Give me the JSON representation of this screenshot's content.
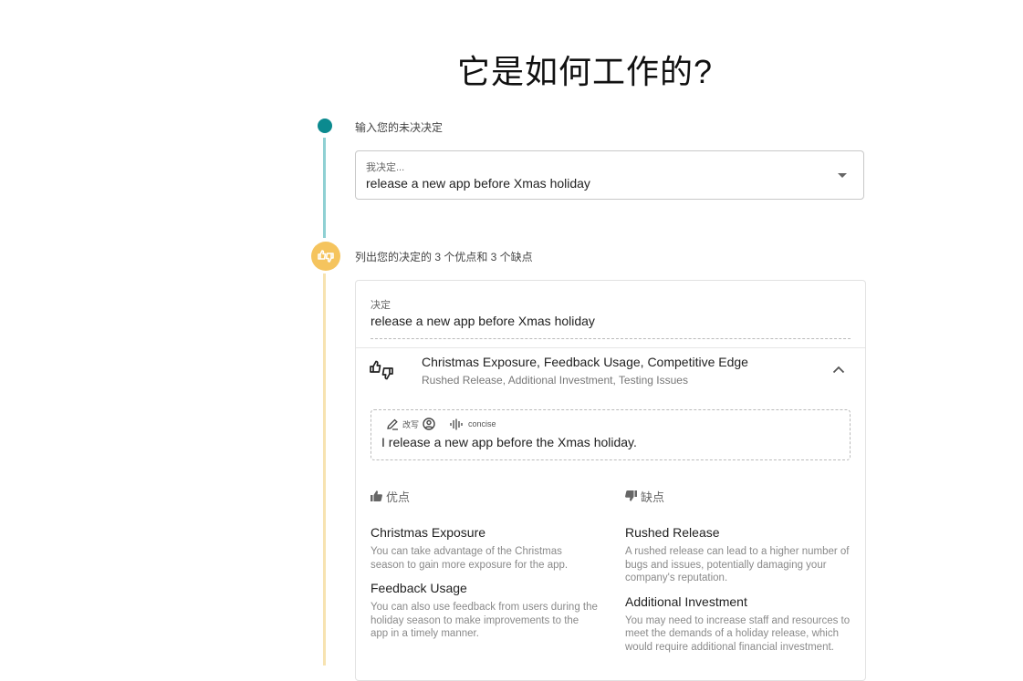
{
  "page": {
    "title": "它是如何工作的?"
  },
  "steps": {
    "step1_label": "输入您的未决决定",
    "step2_label": "列出您的决定的 3 个优点和 3 个缺点"
  },
  "decision_select": {
    "label": "我决定...",
    "value": "release a new app before Xmas holiday"
  },
  "card": {
    "decision_label": "决定",
    "decision_value": "release a new app before Xmas holiday",
    "summary_title": "Christmas Exposure, Feedback Usage, Competitive Edge",
    "summary_subtitle": "Rushed Release, Additional Investment, Testing Issues",
    "edit_box": {
      "tool_rewrite": "改写",
      "tool_tone": "concise",
      "value": "I release a new app before the Xmas holiday."
    },
    "pros": {
      "header": "优点",
      "items": [
        {
          "title": "Christmas Exposure",
          "desc": "You can take advantage of the Christmas season to gain more exposure for the app."
        },
        {
          "title": "Feedback Usage",
          "desc": "You can also use feedback from users during the holiday season to make improvements to the app in a timely manner."
        }
      ]
    },
    "cons": {
      "header": "缺点",
      "items": [
        {
          "title": "Rushed Release",
          "desc": "A rushed release can lead to a higher number of bugs and issues, potentially damaging your company's reputation."
        },
        {
          "title": "Additional Investment",
          "desc": "You may need to increase staff and resources to meet the demands of a holiday release, which would require additional financial investment."
        }
      ]
    }
  },
  "colors": {
    "step1_dot": "#0b8a8f",
    "step1_line": "#8fd0d3",
    "step2_dot": "#f5c45e",
    "step2_line": "#f7e3b1"
  }
}
